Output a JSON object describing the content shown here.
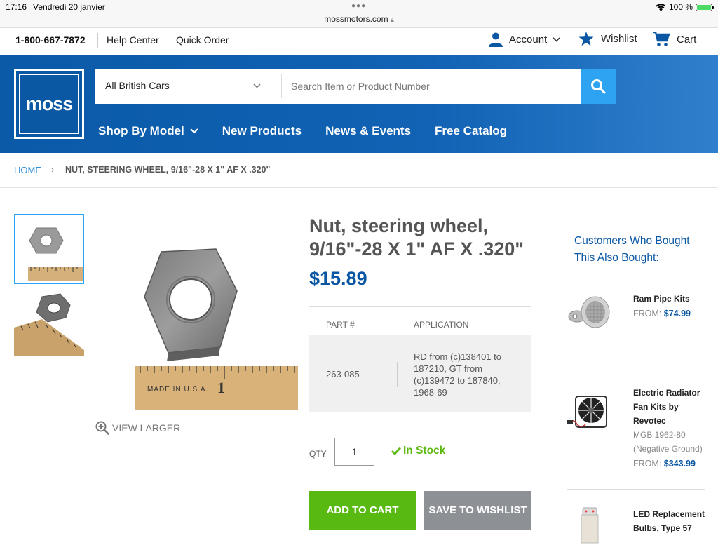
{
  "statusbar": {
    "time": "17:16",
    "date": "Vendredi 20 janvier",
    "url": "mossmotors.com",
    "battery": "100 %",
    "battery_level": 1.0
  },
  "utility": {
    "phone": "1-800-667-7872",
    "help_center": "Help Center",
    "quick_order": "Quick Order",
    "account": "Account",
    "wishlist": "Wishlist",
    "cart": "Cart"
  },
  "header": {
    "logo_text": "moss",
    "category_select": "All British Cars",
    "search_placeholder": "Search Item or Product Number",
    "nav": {
      "shop_by_model": "Shop By Model",
      "new_products": "New Products",
      "news_events": "News & Events",
      "free_catalog": "Free Catalog"
    }
  },
  "breadcrumb": {
    "home": "HOME",
    "current": "NUT, STEERING WHEEL, 9/16\"-28 X 1\" AF X .320\""
  },
  "gallery": {
    "view_larger": "VIEW LARGER"
  },
  "product": {
    "title_line1": "Nut, steering wheel,",
    "title_line2": "9/16\"-28 X 1\" AF X .320\"",
    "price": "$15.89",
    "table": {
      "col_part": "PART #",
      "col_application": "APPLICATION",
      "part_number": "263-085",
      "application": "RD from (c)138401 to 187210, GT from (c)139472 to 187840, 1968-69"
    },
    "qty_label": "QTY",
    "qty_value": "1",
    "stock": "In Stock",
    "add_to_cart": "ADD TO CART",
    "save_to_wishlist": "SAVE TO WISHLIST"
  },
  "sidebar": {
    "title": "Customers Who Bought This Also Bought:",
    "items": [
      {
        "name": "Ram Pipe Kits",
        "from": "FROM:",
        "price": "$74.99"
      },
      {
        "name": "Electric Radiator Fan Kits by Revotec",
        "sub": "MGB 1962-80 (Negative Ground)",
        "from": "FROM:",
        "price": "$343.99"
      },
      {
        "name": "LED Replacement Bulbs, Type 57"
      }
    ]
  },
  "colors": {
    "brand_blue": "#0a57a4",
    "search_button": "#2ea3f2",
    "add_to_cart": "#58b910",
    "wishlist_button": "#8d9196",
    "in_stock": "#5cb80e"
  }
}
